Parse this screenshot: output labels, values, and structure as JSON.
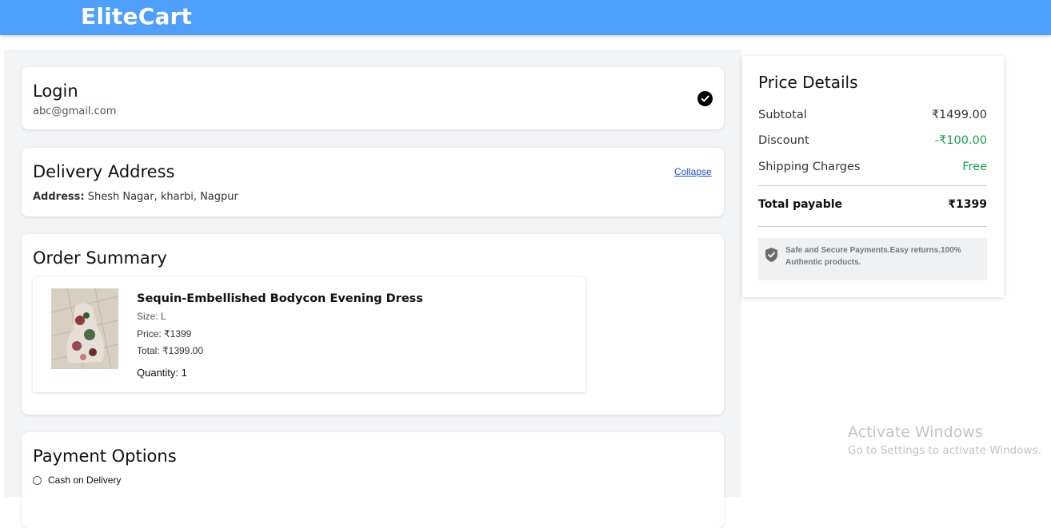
{
  "app": {
    "brand": "EliteCart"
  },
  "login": {
    "title": "Login",
    "email": "abc@gmail.com"
  },
  "delivery": {
    "title": "Delivery Address",
    "collapse_label": "Collapse",
    "address_label": "Address:",
    "address_value": "Shesh Nagar, kharbi, Nagpur"
  },
  "order": {
    "title": "Order Summary",
    "item": {
      "name": "Sequin-Embellished Bodycon Evening Dress",
      "size": "Size: L",
      "price": "Price: ₹1399",
      "total": "Total: ₹1399.00",
      "quantity": "Quantity: 1"
    }
  },
  "payment": {
    "title": "Payment Options",
    "option_cod": "Cash on Delivery"
  },
  "price_details": {
    "title": "Price Details",
    "subtotal_label": "Subtotal",
    "subtotal_value": "₹1499.00",
    "discount_label": "Discount",
    "discount_value": "-₹100.00",
    "shipping_label": "Shipping Charges",
    "shipping_value": "Free",
    "total_label": "Total payable",
    "total_value": "₹1399",
    "secure_text": "Safe and Secure Payments.Easy returns.100% Authentic products."
  },
  "watermark": {
    "line1": "Activate Windows",
    "line2": "Go to Settings to activate Windows."
  },
  "colors": {
    "header": "#4f9ffd",
    "green": "#16a34a",
    "link": "#1d4ed8"
  }
}
